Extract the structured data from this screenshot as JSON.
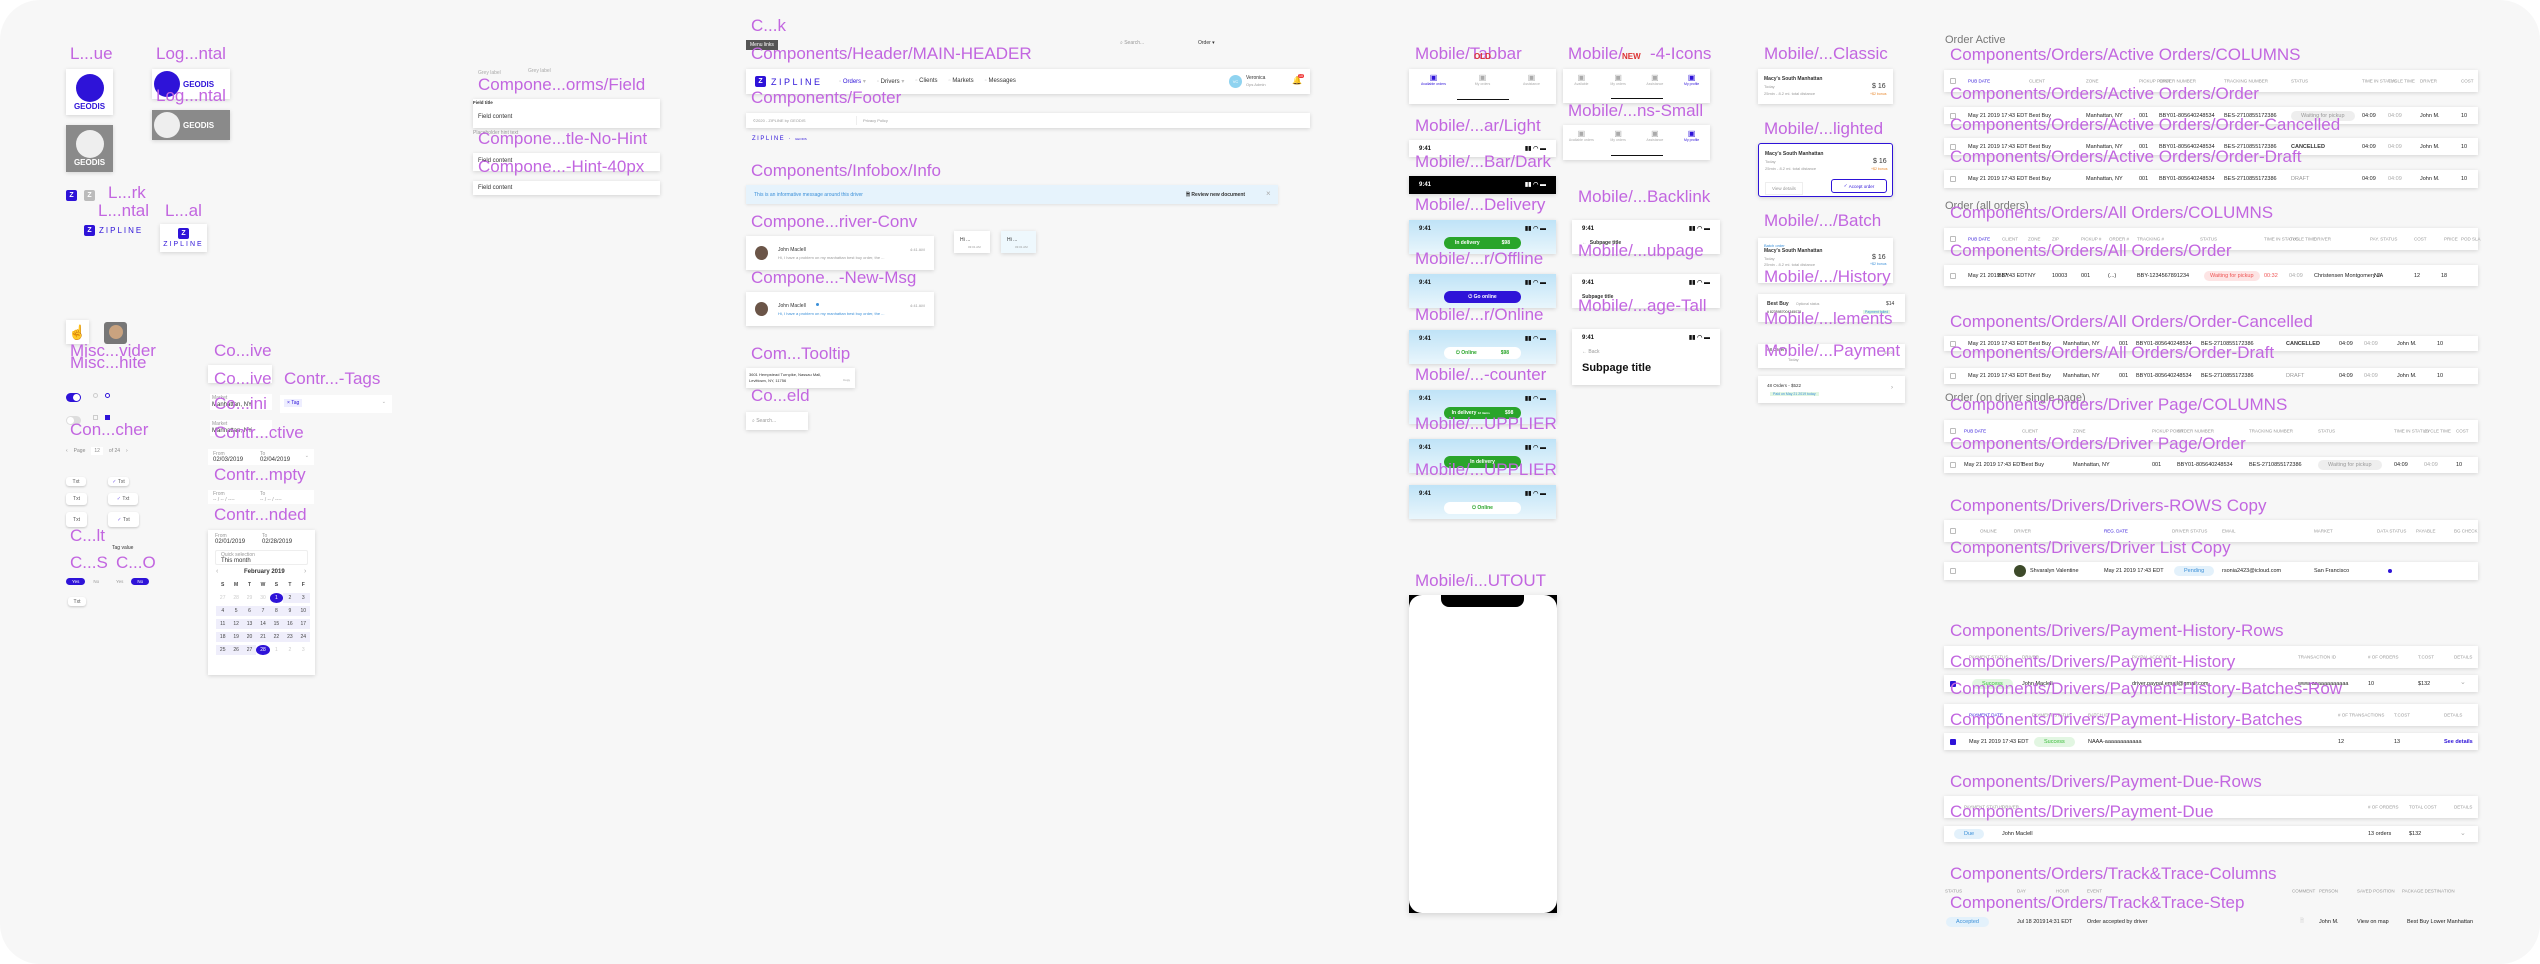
{
  "labels": {
    "logo_vertical": "L...ue",
    "logo_horizontal": "Log...ntal",
    "logo_horizontal_grey": "Log...ntal",
    "logo_dark": "L...rk",
    "logo_zip_h": "L...ntal",
    "logo_zip_v": "L...al",
    "field": "Compone...orms/Field",
    "field_no_hint": "Compone...tle-No-Hint",
    "field_40": "Compone...-Hint-40px",
    "misc_divider": "Misc...vider",
    "misc_white": "Misc...hite",
    "co_ive1": "Co...ive",
    "co_ive2": "Co...ive",
    "tags": "Contr...-Tags",
    "co_ini": "Co...ini",
    "ctive": "Contr...ctive",
    "switcher": "Con...cher",
    "mpty": "Contr...mpty",
    "nded": "Contr...nded",
    "c_lt": "C...lt",
    "c_s": "C...S",
    "c_o": "C...O",
    "ck": "C...k",
    "header": "Components/Header/MAIN-HEADER",
    "footer": "Components/Footer",
    "infobox": "Components/Infobox/Info",
    "conv": "Compone...river-Conv",
    "newmsg": "Compone...-New-Msg",
    "tooltip": "Com...Tooltip",
    "search": "Co...eld",
    "tabbar": "Mobile/Tabbar",
    "tabbar_old": "OLD",
    "icons4": "Mobile/",
    "icons4_new": "NEW",
    "icons4_b": "-4-Icons",
    "icons_small": "Mobile/...ns-Small",
    "sb_light": "Mobile/...ar/Light",
    "sb_dark": "Mobile/...Bar/Dark",
    "delivery": "Mobile/...Delivery",
    "offline": "Mobile/...r/Offline",
    "online": "Mobile/...r/Online",
    "counter": "Mobile/...-counter",
    "supplier1": "Mobile/...UPPLIER",
    "supplier2": "Mobile/...UPPLIER",
    "cutout": "Mobile/i...UTOUT",
    "backlink": "Mobile/...Backlink",
    "subpage": "Mobile/...ubpage",
    "tall": "Mobile/...age-Tall",
    "classic": "Mobile/...Classic",
    "highlighted": "Mobile/...lighted",
    "batch": "Mobile/.../Batch",
    "history": "Mobile/.../History",
    "elements": "Mobile/...lements",
    "payment": "Mobile/...Payment",
    "order_active": "Order Active",
    "ao_cols": "Components/Orders/Active Orders/COLUMNS",
    "ao_order": "Components/Orders/Active Orders/Order",
    "ao_cancel": "Components/Orders/Active Orders/Order-Cancelled",
    "ao_draft": "Components/Orders/Active Orders/Order-Draft",
    "order_all": "Order (all orders)",
    "all_cols": "Components/Orders/All Orders/COLUMNS",
    "all_order": "Components/Orders/All Orders/Order",
    "all_cancel": "Components/Orders/All Orders/Order-Cancelled",
    "all_draft": "Components/Orders/All Orders/Order-Draft",
    "order_driver": "Order (on driver single page)",
    "dp_cols": "Components/Orders/Driver Page/COLUMNS",
    "dp_order": "Components/Orders/Driver Page/Order",
    "drv_rows": "Components/Drivers/Drivers-ROWS Copy",
    "drv_list": "Components/Drivers/Driver List Copy",
    "ph_rows": "Components/Drivers/Payment-History-Rows",
    "ph": "Components/Drivers/Payment-History",
    "phb_row": "Components/Drivers/Payment-History-Batches-Row",
    "phb": "Components/Drivers/Payment-History-Batches",
    "pd_rows": "Components/Drivers/Payment-Due-Rows",
    "pd": "Components/Drivers/Payment-Due",
    "tt_cols": "Components/Orders/Track&Trace-Columns",
    "tt_step": "Components/Orders/Track&Trace-Step"
  },
  "logos": {
    "geodis": "GEODIS",
    "zipline": "ZIPLINE",
    "z": "Z"
  },
  "forms": {
    "grey_label_1": "Grey label",
    "grey_label_2": "Grey label",
    "field_title": "Field title",
    "field_content": "Field content",
    "hint": "Placeholder hint text",
    "field_content_2": "Field content",
    "field_content_3": "Field content"
  },
  "controls": {
    "market_label": "Market",
    "market_value": "Manhattan, NY",
    "tag": "Tag",
    "from": "From",
    "to": "To",
    "from_val": "02/03/2019",
    "to_val": "02/04/2019",
    "empty_from": "-- / -- / ----",
    "empty_to": "-- / -- / ----",
    "pagination": {
      "page": "Page",
      "current": "12",
      "of": "of 24"
    },
    "chips": [
      "Txt",
      "Txt",
      "Txt",
      "Txt",
      "Txt",
      "Txt",
      "Txt"
    ],
    "tag_value": "Tag value",
    "yes": "Yes",
    "no": "No",
    "calendar": {
      "from_val": "02/01/2019",
      "to_val": "02/28/2019",
      "quick_label": "Quick selection",
      "quick_value": "This month",
      "month": "February 2019",
      "weekdays": [
        "S",
        "M",
        "T",
        "W",
        "S",
        "T",
        "F"
      ],
      "days": [
        "27",
        "28",
        "29",
        "30",
        "1",
        "2",
        "3",
        "4",
        "5",
        "6",
        "7",
        "8",
        "9",
        "10",
        "11",
        "12",
        "13",
        "14",
        "15",
        "16",
        "17",
        "18",
        "19",
        "20",
        "21",
        "22",
        "23",
        "24",
        "25",
        "26",
        "27",
        "28",
        "1",
        "2",
        "3"
      ]
    }
  },
  "header": {
    "menu_links": "Menu links",
    "search_placeholder": "Search...",
    "order_select": "Order",
    "brand": "ZIPLINE",
    "nav": [
      "Orders",
      "Drivers",
      "Clients",
      "Markets",
      "Messages"
    ],
    "user_name": "Veronica",
    "user_role": "Ops Admin",
    "avatar_initials": "VC",
    "notif_count": "10"
  },
  "footer": {
    "copyright": "©2020 - ZIPLINE by GEODIS",
    "privacy": "Privacy Policy",
    "brand_small": "ZIPLINE",
    "by": "GEODIS"
  },
  "infobox": {
    "message": "This is an informative message around this driver",
    "action": "Review new document"
  },
  "conv": {
    "name": "John Maclell",
    "time": "4:41 AM",
    "preview": "Hi, I have a problem on my manhattan best buy order, the ...",
    "bubble1": "Hi ...",
    "bubble2": "Hi ...",
    "bubble_time": "03:01 AM"
  },
  "tooltip": {
    "address": "3601 Hempstead Turnpike, Nassau Mall, Levittown, NY, 11756",
    "copy": "Copy"
  },
  "mobile": {
    "time": "9:41",
    "tabbar_old": [
      "Available orders",
      "My orders",
      "Assistance"
    ],
    "tabbar_new": [
      "Available",
      "My orders",
      "Assistance",
      "My profile"
    ],
    "tabbar_small": [
      "Available orders",
      "My orders",
      "Assistance",
      "My profile"
    ],
    "in_delivery": "In delivery",
    "earned": "$98",
    "earned_label": "Earned today",
    "go_online": "Go online",
    "online": "Online",
    "items": "12 items",
    "content": "Content",
    "subpage_title": "Subpage title",
    "back": "Back",
    "order_title": "Macy's South Manhattan",
    "today": "Today",
    "distance": "25min - 8.2 mi. total distance",
    "price": "$ 16",
    "bonus": "+$2 bonus",
    "view_details": "View details",
    "accept": "Accept order",
    "batch_order": "Batch order",
    "history": {
      "name": "Best Buy",
      "status": "Optional status",
      "amount": "$14",
      "number": "# 8235987004345078",
      "badge": "Payment failed"
    },
    "elements": {
      "orders": "48 Orders",
      "date": "Today",
      "amount": "$522"
    },
    "payment": {
      "title": "48 Orders - $522",
      "paid": "Paid on May 21 2019 today"
    }
  },
  "tables": {
    "ao_cols": [
      "PUB DATE",
      "CLIENT",
      "ZONE",
      "PICKUP POINT",
      "ORDER NUMBER",
      "TRACKING NUMBER",
      "STATUS",
      "TIME IN STATUS",
      "CYCLE TIME",
      "DRIVER",
      "COST"
    ],
    "ao_order": [
      "May 21 2019 17:43 EDT",
      "Best Buy",
      "Manhattan, NY",
      "001",
      "BBY01-805640248534",
      "BES-2710855172386",
      "Waiting for pickup",
      "04:09",
      "04:09",
      "John M.",
      "10"
    ],
    "ao_cancel": [
      "May 21 2019 17:43 EDT",
      "Best Buy",
      "Manhattan, NY",
      "001",
      "BBY01-805640248534",
      "BES-2710855172386",
      "CANCELLED",
      "04:09",
      "04:09",
      "John M.",
      "10"
    ],
    "ao_draft": [
      "May 21 2019 17:43 EDT",
      "Best Buy",
      "Manhattan, NY",
      "001",
      "BBY01-805640248534",
      "BES-2710855172386",
      "DRAFT",
      "04:09",
      "04:09",
      "John M.",
      "10"
    ],
    "all_cols": [
      "PUB DATE",
      "CLIENT",
      "ZONE",
      "ZIP",
      "PICKUP #",
      "ORDER #",
      "TRACKING #",
      "STATUS",
      "TIME IN STATUS",
      "CYCLE TIME",
      "DRIVER",
      "PAY. STATUS",
      "COST",
      "PRICE",
      "POD",
      "SLA"
    ],
    "all_order": [
      "May 21 2019 17:43 EDT",
      "BBY",
      "NY",
      "10003",
      "001",
      "(...)",
      "BBY-1234567891234",
      "Waiting for pickup",
      "00:32",
      "04:09",
      "Christensen Montgomery J.",
      "N/A",
      "12",
      "18"
    ],
    "all_cancel": [
      "May 21 2019 17:43 EDT",
      "Best Buy",
      "Manhattan, NY",
      "001",
      "BBY01-805640248534",
      "BES-2710855172386",
      "CANCELLED",
      "04:09",
      "04:09",
      "John M.",
      "10"
    ],
    "all_draft": [
      "May 21 2019 17:43 EDT",
      "Best Buy",
      "Manhattan, NY",
      "001",
      "BBY01-805640248534",
      "BES-2710855172386",
      "DRAFT",
      "04:09",
      "04:09",
      "John M.",
      "10"
    ],
    "dp_cols": [
      "PUB DATE",
      "CLIENT",
      "ZONE",
      "PICKUP POINT",
      "ORDER NUMBER",
      "TRACKING NUMBER",
      "STATUS",
      "TIME IN STATUS",
      "CYCLE TIME",
      "COST"
    ],
    "dp_order": [
      "May 21 2019 17:43 EDT",
      "Best Buy",
      "Manhattan, NY",
      "001",
      "BBY01-805640248534",
      "BES-2710855172386",
      "Waiting for pickup",
      "04:09",
      "04:09",
      "10"
    ],
    "drv_cols": [
      "ONLINE",
      "DRIVER",
      "REG. DATE",
      "DRIVER STATUS",
      "EMAIL",
      "MARKET",
      "DATA STATUS",
      "PAYABLE",
      "BG CHECK"
    ],
    "drv_row": [
      "Shvaralyn Valentine",
      "May 21 2019 17:43 EDT",
      "Pending",
      "rsonia2423@icloud.com",
      "San Francisco"
    ],
    "ph_cols": [
      "PAYMENT STATUS",
      "DRIVER",
      "PAYPAL ACCOUNT",
      "TRANSACTION ID",
      "# OF ORDERS",
      "T.COST",
      "DETAILS"
    ],
    "ph_row": [
      "Success",
      "John Maclell",
      "driver.paypal.email@gmail.com",
      "www-aaaaaaaaaaaa",
      "10",
      "$132"
    ],
    "phb_cols": [
      "PAYMENT DATE",
      "PAYMENT STATUS",
      "BATCH ID",
      "# OF TRANSACTIONS",
      "T.COST",
      "DETAILS"
    ],
    "phb_row": [
      "May 21 2019 17:43 EDT",
      "Success",
      "NAAA-aaaaaaaaaaaa",
      "12",
      "13",
      "See details"
    ],
    "pd_cols": [
      "PAYMENT STATUS",
      "DRIVER",
      "# OF ORDERS",
      "TOTAL COST",
      "DETAILS"
    ],
    "pd_row": [
      "Due",
      "John Maclell",
      "13 orders",
      "$132"
    ],
    "tt_cols": [
      "STATUS",
      "DAY",
      "HOUR",
      "EVENT",
      "COMMENT",
      "PERSON",
      "SAVED POSITION",
      "PACKAGE DESTINATION"
    ],
    "tt_row": [
      "Accepted",
      "Jul 18 2019",
      "14:31 EDT",
      "Order accepted by driver",
      "John M.",
      "View on map",
      "Best Buy Lower Manhattan"
    ]
  },
  "colors": {
    "brand": "#2e13d8",
    "label": "#c266e0",
    "delivery_green": "#2aa52a",
    "canvas": "#f7f7f7"
  }
}
